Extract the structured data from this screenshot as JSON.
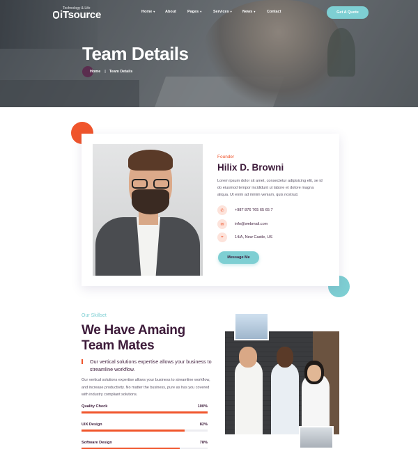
{
  "header": {
    "logo_name": "iTsource",
    "logo_tagline": "Technology & Life",
    "nav": [
      {
        "label": "Home",
        "dropdown": true
      },
      {
        "label": "About",
        "dropdown": false
      },
      {
        "label": "Pages",
        "dropdown": true
      },
      {
        "label": "Services",
        "dropdown": true
      },
      {
        "label": "News",
        "dropdown": true
      },
      {
        "label": "Contact",
        "dropdown": false
      }
    ],
    "cta_label": "Get A Quote"
  },
  "hero": {
    "title": "Team Details",
    "breadcrumb_home": "Home",
    "breadcrumb_separator": "|",
    "breadcrumb_current": "Team Details"
  },
  "profile": {
    "role": "Founder",
    "name": "Hilix D. Browni",
    "bio": "Lorem ipsum dolor sit amet, consectetur adipisicing elit, se id do eiusmod tempor incididunt ut labore et dolore magna aliqua. Ut enim ad minim veniam, quis nostrud.",
    "contacts": [
      {
        "icon": "phone-icon",
        "glyph": "✆",
        "value": "+987 876 765 65 65 7"
      },
      {
        "icon": "mail-icon",
        "glyph": "✉",
        "value": "info@webmail.com"
      },
      {
        "icon": "location-icon",
        "glyph": "⌖",
        "value": "14/A, New Castle, US"
      }
    ],
    "message_button": "Message Me"
  },
  "skillset": {
    "subtitle": "Our Skillset",
    "heading_line1": "We Have Amaing",
    "heading_line2": "Team Mates",
    "lead": "Our vertical solutions expertise allows your business to streamline workflow.",
    "paragraph": "Our vertical solutions expertise allows your business to streamline workflow, and increase productivity. No matter the business, pure as has you covered with industry compliant solutions.",
    "skills": [
      {
        "label": "Quality Check",
        "value": "100%",
        "percent": 100
      },
      {
        "label": "UIX Design",
        "value": "82%",
        "percent": 82
      },
      {
        "label": "Software Design",
        "value": "78%",
        "percent": 78
      }
    ]
  },
  "colors": {
    "accent_orange": "#f0552c",
    "accent_teal": "#7ecfd3",
    "heading_purple": "#3d1b3a"
  }
}
